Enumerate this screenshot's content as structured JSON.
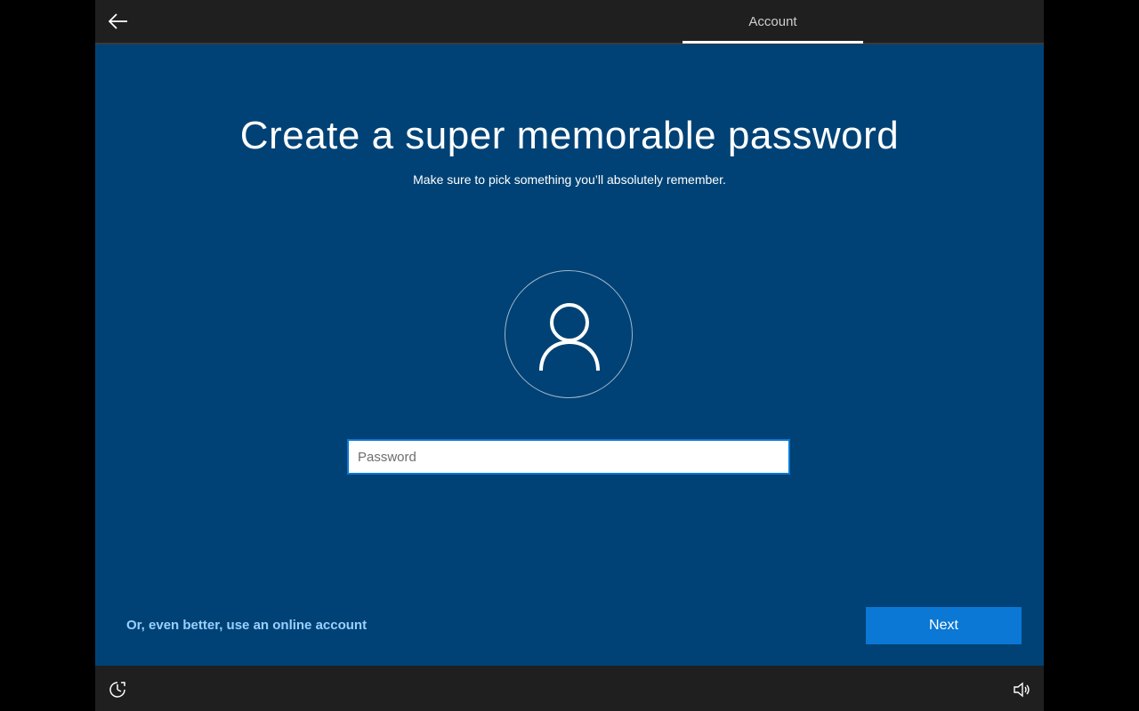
{
  "header": {
    "back_icon": "back-arrow-icon",
    "active_tab": "Account"
  },
  "main": {
    "title": "Create a super memorable password",
    "subtitle": "Make sure to pick something you’ll absolutely remember.",
    "avatar_icon": "user-icon",
    "password_placeholder": "Password",
    "password_value": ""
  },
  "footer": {
    "online_account_link": "Or, even better, use an online account",
    "next_label": "Next"
  },
  "bottombar": {
    "left_icon": "ease-of-access-icon",
    "right_icon": "volume-icon"
  },
  "colors": {
    "background": "#004275",
    "bar": "#1f1f1f",
    "accent": "#0a78d4",
    "link": "#99d0ff"
  }
}
